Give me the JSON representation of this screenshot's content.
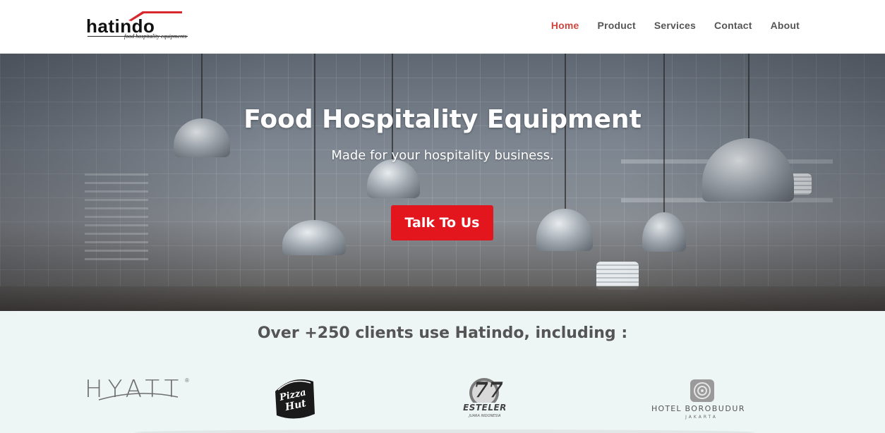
{
  "header": {
    "logo": {
      "word": "hatindo",
      "tagline": "food hospitality equipments",
      "brand_color": "#d8272d"
    },
    "nav": [
      {
        "label": "Home",
        "active": true
      },
      {
        "label": "Product",
        "active": false
      },
      {
        "label": "Services",
        "active": false
      },
      {
        "label": "Contact",
        "active": false
      },
      {
        "label": "About",
        "active": false
      }
    ],
    "active_color": "#d0453d"
  },
  "hero": {
    "title": "Food Hospitality Equipment",
    "subtitle": "Made for your hospitality business.",
    "cta_label": "Talk To Us",
    "cta_color": "#e3161d"
  },
  "clients": {
    "title": "Over +250 clients use Hatindo, including :",
    "logos": [
      {
        "name": "HYATT",
        "icon": "hyatt-logo"
      },
      {
        "name": "Pizza Hut",
        "icon": "pizza-hut-logo",
        "lines": [
          "Pizza",
          "Hut"
        ]
      },
      {
        "name": "ESTELER 77",
        "icon": "esteler-77-logo",
        "number": "77",
        "caption": "ESTELER",
        "sub": "JUARA INDONESIA"
      },
      {
        "name": "HOTEL BOROBUDUR",
        "icon": "hotel-borobudur-logo",
        "prefix": "HOTEL",
        "word": "BOROBUDUR",
        "city": "JAKARTA"
      }
    ]
  }
}
